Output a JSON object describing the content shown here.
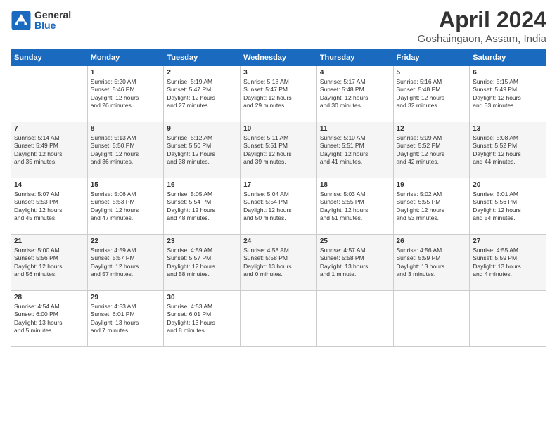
{
  "header": {
    "logo_general": "General",
    "logo_blue": "Blue",
    "title": "April 2024",
    "location": "Goshaingaon, Assam, India"
  },
  "days_of_week": [
    "Sunday",
    "Monday",
    "Tuesday",
    "Wednesday",
    "Thursday",
    "Friday",
    "Saturday"
  ],
  "weeks": [
    [
      {
        "day": "",
        "info": ""
      },
      {
        "day": "1",
        "info": "Sunrise: 5:20 AM\nSunset: 5:46 PM\nDaylight: 12 hours\nand 26 minutes."
      },
      {
        "day": "2",
        "info": "Sunrise: 5:19 AM\nSunset: 5:47 PM\nDaylight: 12 hours\nand 27 minutes."
      },
      {
        "day": "3",
        "info": "Sunrise: 5:18 AM\nSunset: 5:47 PM\nDaylight: 12 hours\nand 29 minutes."
      },
      {
        "day": "4",
        "info": "Sunrise: 5:17 AM\nSunset: 5:48 PM\nDaylight: 12 hours\nand 30 minutes."
      },
      {
        "day": "5",
        "info": "Sunrise: 5:16 AM\nSunset: 5:48 PM\nDaylight: 12 hours\nand 32 minutes."
      },
      {
        "day": "6",
        "info": "Sunrise: 5:15 AM\nSunset: 5:49 PM\nDaylight: 12 hours\nand 33 minutes."
      }
    ],
    [
      {
        "day": "7",
        "info": "Sunrise: 5:14 AM\nSunset: 5:49 PM\nDaylight: 12 hours\nand 35 minutes."
      },
      {
        "day": "8",
        "info": "Sunrise: 5:13 AM\nSunset: 5:50 PM\nDaylight: 12 hours\nand 36 minutes."
      },
      {
        "day": "9",
        "info": "Sunrise: 5:12 AM\nSunset: 5:50 PM\nDaylight: 12 hours\nand 38 minutes."
      },
      {
        "day": "10",
        "info": "Sunrise: 5:11 AM\nSunset: 5:51 PM\nDaylight: 12 hours\nand 39 minutes."
      },
      {
        "day": "11",
        "info": "Sunrise: 5:10 AM\nSunset: 5:51 PM\nDaylight: 12 hours\nand 41 minutes."
      },
      {
        "day": "12",
        "info": "Sunrise: 5:09 AM\nSunset: 5:52 PM\nDaylight: 12 hours\nand 42 minutes."
      },
      {
        "day": "13",
        "info": "Sunrise: 5:08 AM\nSunset: 5:52 PM\nDaylight: 12 hours\nand 44 minutes."
      }
    ],
    [
      {
        "day": "14",
        "info": "Sunrise: 5:07 AM\nSunset: 5:53 PM\nDaylight: 12 hours\nand 45 minutes."
      },
      {
        "day": "15",
        "info": "Sunrise: 5:06 AM\nSunset: 5:53 PM\nDaylight: 12 hours\nand 47 minutes."
      },
      {
        "day": "16",
        "info": "Sunrise: 5:05 AM\nSunset: 5:54 PM\nDaylight: 12 hours\nand 48 minutes."
      },
      {
        "day": "17",
        "info": "Sunrise: 5:04 AM\nSunset: 5:54 PM\nDaylight: 12 hours\nand 50 minutes."
      },
      {
        "day": "18",
        "info": "Sunrise: 5:03 AM\nSunset: 5:55 PM\nDaylight: 12 hours\nand 51 minutes."
      },
      {
        "day": "19",
        "info": "Sunrise: 5:02 AM\nSunset: 5:55 PM\nDaylight: 12 hours\nand 53 minutes."
      },
      {
        "day": "20",
        "info": "Sunrise: 5:01 AM\nSunset: 5:56 PM\nDaylight: 12 hours\nand 54 minutes."
      }
    ],
    [
      {
        "day": "21",
        "info": "Sunrise: 5:00 AM\nSunset: 5:56 PM\nDaylight: 12 hours\nand 56 minutes."
      },
      {
        "day": "22",
        "info": "Sunrise: 4:59 AM\nSunset: 5:57 PM\nDaylight: 12 hours\nand 57 minutes."
      },
      {
        "day": "23",
        "info": "Sunrise: 4:59 AM\nSunset: 5:57 PM\nDaylight: 12 hours\nand 58 minutes."
      },
      {
        "day": "24",
        "info": "Sunrise: 4:58 AM\nSunset: 5:58 PM\nDaylight: 13 hours\nand 0 minutes."
      },
      {
        "day": "25",
        "info": "Sunrise: 4:57 AM\nSunset: 5:58 PM\nDaylight: 13 hours\nand 1 minute."
      },
      {
        "day": "26",
        "info": "Sunrise: 4:56 AM\nSunset: 5:59 PM\nDaylight: 13 hours\nand 3 minutes."
      },
      {
        "day": "27",
        "info": "Sunrise: 4:55 AM\nSunset: 5:59 PM\nDaylight: 13 hours\nand 4 minutes."
      }
    ],
    [
      {
        "day": "28",
        "info": "Sunrise: 4:54 AM\nSunset: 6:00 PM\nDaylight: 13 hours\nand 5 minutes."
      },
      {
        "day": "29",
        "info": "Sunrise: 4:53 AM\nSunset: 6:01 PM\nDaylight: 13 hours\nand 7 minutes."
      },
      {
        "day": "30",
        "info": "Sunrise: 4:53 AM\nSunset: 6:01 PM\nDaylight: 13 hours\nand 8 minutes."
      },
      {
        "day": "",
        "info": ""
      },
      {
        "day": "",
        "info": ""
      },
      {
        "day": "",
        "info": ""
      },
      {
        "day": "",
        "info": ""
      }
    ]
  ]
}
